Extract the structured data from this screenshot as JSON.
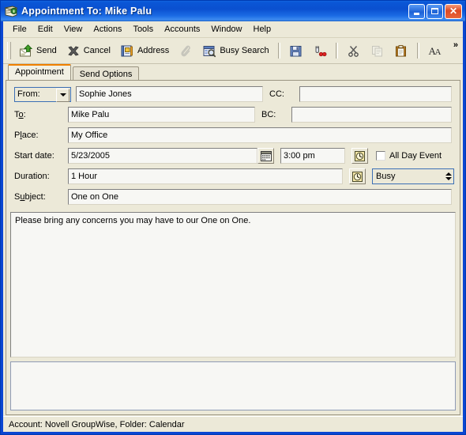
{
  "window": {
    "title": "Appointment To: Mike Palu",
    "icon": "appointment-book-icon",
    "controls": {
      "minimize": "Minimize",
      "maximize": "Maximize",
      "close": "Close"
    }
  },
  "menubar": {
    "items": [
      {
        "label": "File"
      },
      {
        "label": "Edit"
      },
      {
        "label": "View"
      },
      {
        "label": "Actions"
      },
      {
        "label": "Tools"
      },
      {
        "label": "Accounts"
      },
      {
        "label": "Window"
      },
      {
        "label": "Help"
      }
    ]
  },
  "toolbar": {
    "buttons": [
      {
        "label": "Send",
        "icon": "send-envelope-icon"
      },
      {
        "label": "Cancel",
        "icon": "cancel-x-icon"
      },
      {
        "label": "Address",
        "icon": "address-book-icon"
      },
      {
        "label": "",
        "icon": "paperclip-icon"
      },
      {
        "label": "Busy Search",
        "icon": "busy-search-icon"
      },
      {
        "label": "",
        "icon": "save-floppy-icon"
      },
      {
        "label": "",
        "icon": "spell-check-icon"
      },
      {
        "label": "",
        "icon": "cut-scissors-icon"
      },
      {
        "label": "",
        "icon": "copy-icon"
      },
      {
        "label": "",
        "icon": "paste-clipboard-icon"
      },
      {
        "label": "",
        "icon": "font-icon"
      }
    ],
    "overflow": "»"
  },
  "tabs": [
    {
      "label": "Appointment",
      "active": true
    },
    {
      "label": "Send Options",
      "active": false
    }
  ],
  "form": {
    "from": {
      "label": "From:",
      "value": "Sophie Jones"
    },
    "cc": {
      "label": "CC:",
      "value": ""
    },
    "to": {
      "label_pre": "T",
      "label_acc": "o",
      "label_post": ":",
      "value": "Mike Palu"
    },
    "bc": {
      "label": "BC:",
      "value": ""
    },
    "place": {
      "label_pre": "P",
      "label_acc": "l",
      "label_post": "ace:",
      "value": "My Office"
    },
    "start_date": {
      "label": "Start date:",
      "value": "5/23/2005",
      "icon": "calendar-icon"
    },
    "start_time": {
      "value": "3:00 pm",
      "icon": "clock-icon"
    },
    "all_day_event": {
      "label": "All Day Event",
      "checked": false
    },
    "duration": {
      "label": "Duration:",
      "value": "1 Hour",
      "icon": "clock-icon"
    },
    "show_as": {
      "value": "Busy"
    },
    "subject": {
      "label_pre": "S",
      "label_acc": "u",
      "label_post": "bject:",
      "value": "One on One"
    },
    "message": {
      "value": "Please bring any concerns you may have to our One on One."
    },
    "attachments": {
      "value": ""
    }
  },
  "statusbar": {
    "text": "Account: Novell GroupWise,  Folder: Calendar"
  },
  "colors": {
    "titlebar_blue": "#0A46D2",
    "face": "#ECE9D8",
    "field_bg": "#F7F7F4",
    "active_tab_accent": "#F08000",
    "close_red": "#DD4A25"
  }
}
